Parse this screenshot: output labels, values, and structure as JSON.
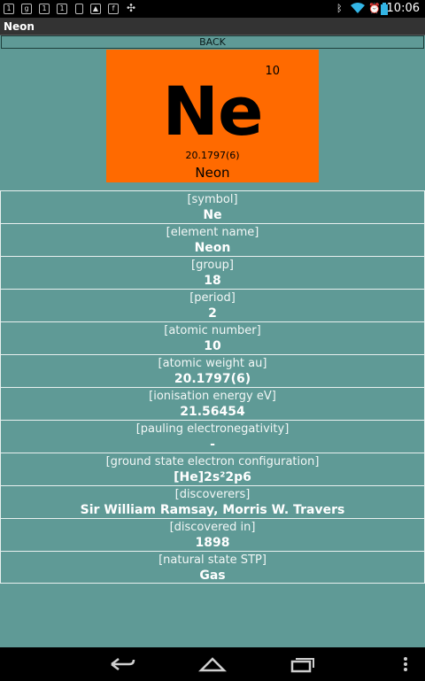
{
  "status_bar": {
    "time": "10:06",
    "left_icons": [
      "1-notif-icon",
      "google-plus-icon",
      "1-notif-icon",
      "1-notif-icon",
      "sim-icon",
      "image-icon",
      "facebook-icon",
      "sync-icon"
    ],
    "right_icons": [
      "bluetooth-icon",
      "wifi-icon",
      "battery-icon"
    ]
  },
  "title": "Neon",
  "back_label": "BACK",
  "tile": {
    "atomic_number": "10",
    "symbol": "Ne",
    "weight": "20.1797(6)",
    "name": "Neon",
    "color": "#ff6a00"
  },
  "properties": [
    {
      "label": "[symbol]",
      "value": "Ne"
    },
    {
      "label": "[element name]",
      "value": "Neon"
    },
    {
      "label": "[group]",
      "value": "18"
    },
    {
      "label": "[period]",
      "value": "2"
    },
    {
      "label": "[atomic number]",
      "value": "10"
    },
    {
      "label": "[atomic weight au]",
      "value": "20.1797(6)"
    },
    {
      "label": "[ionisation energy eV]",
      "value": "21.56454"
    },
    {
      "label": "[pauling electronegativity]",
      "value": "-"
    },
    {
      "label": "[ground state electron configuration]",
      "value": "[He]2s²2p6"
    },
    {
      "label": "[discoverers]",
      "value": "Sir William Ramsay, Morris W. Travers"
    },
    {
      "label": "[discovered in]",
      "value": "1898"
    },
    {
      "label": "[natural state STP]",
      "value": "Gas"
    }
  ],
  "nav": [
    "back-icon",
    "home-icon",
    "recent-apps-icon",
    "overflow-menu-icon"
  ]
}
